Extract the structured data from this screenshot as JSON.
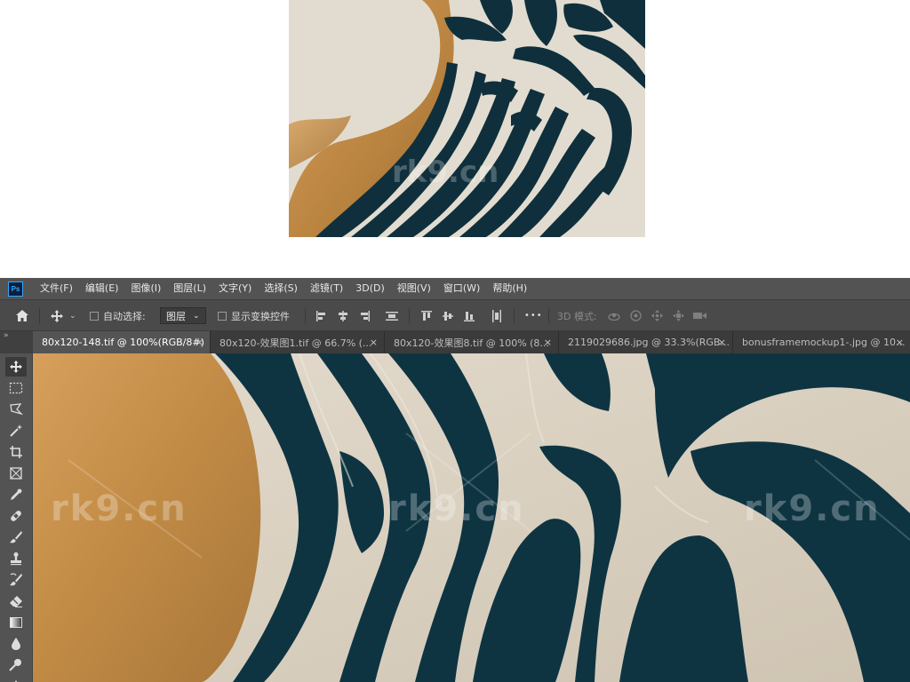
{
  "app": {
    "logo_text": "Ps",
    "brand_color": "#31a8ff"
  },
  "menu": [
    {
      "label": "文件(F)"
    },
    {
      "label": "编辑(E)"
    },
    {
      "label": "图像(I)"
    },
    {
      "label": "图层(L)"
    },
    {
      "label": "文字(Y)"
    },
    {
      "label": "选择(S)"
    },
    {
      "label": "滤镜(T)"
    },
    {
      "label": "3D(D)"
    },
    {
      "label": "视图(V)"
    },
    {
      "label": "窗口(W)"
    },
    {
      "label": "帮助(H)"
    }
  ],
  "options": {
    "auto_select_label": "自动选择:",
    "auto_select_checked": false,
    "target_value": "图层",
    "show_transform_label": "显示变换控件",
    "show_transform_checked": false,
    "more_label": "•••",
    "mode_3d_label": "3D 模式:"
  },
  "panel_collapse": "»",
  "tabs": [
    {
      "title": "80x120-148.tif @ 100%(RGB/8#)",
      "active": true,
      "close": "×"
    },
    {
      "title": "80x120-效果图1.tif @ 66.7% (...",
      "active": false,
      "close": "×"
    },
    {
      "title": "80x120-效果图8.tif @ 100% (8...",
      "active": false,
      "close": "×"
    },
    {
      "title": "2119029686.jpg @ 33.3%(RGB...",
      "active": false,
      "close": "×"
    },
    {
      "title": "bonusframemockup1-.jpg @ 10...",
      "active": false,
      "close": "×"
    }
  ],
  "tools": [
    {
      "icon": "move-tool-icon",
      "active": true
    },
    {
      "icon": "marquee-tool-icon"
    },
    {
      "icon": "lasso-tool-icon"
    },
    {
      "icon": "magic-wand-tool-icon"
    },
    {
      "icon": "crop-tool-icon"
    },
    {
      "icon": "frame-tool-icon"
    },
    {
      "icon": "eyedropper-tool-icon"
    },
    {
      "icon": "healing-brush-tool-icon"
    },
    {
      "icon": "brush-tool-icon"
    },
    {
      "icon": "clone-stamp-tool-icon"
    },
    {
      "icon": "history-brush-tool-icon"
    },
    {
      "icon": "eraser-tool-icon"
    },
    {
      "icon": "gradient-tool-icon"
    },
    {
      "icon": "blur-tool-icon"
    },
    {
      "icon": "dodge-tool-icon"
    },
    {
      "icon": "pen-tool-icon"
    }
  ],
  "watermark": "rk9.cn",
  "artwork_colors": {
    "gold": "#c08a45",
    "navy": "#0f3440",
    "cream": "#ddd4c4"
  }
}
